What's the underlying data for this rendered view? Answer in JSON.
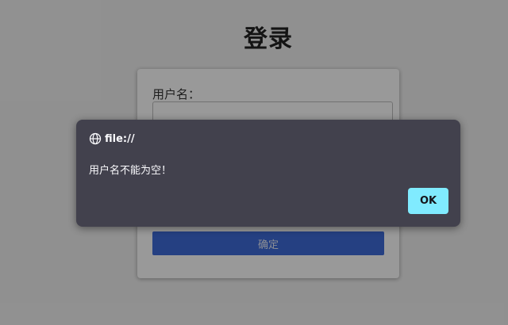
{
  "page": {
    "title": "登录"
  },
  "login_form": {
    "username_label": "用户名：",
    "username_value": "",
    "submit_label": "确定"
  },
  "alert": {
    "origin": "file://",
    "origin_icon": "globe-icon",
    "message": "用户名不能为空！",
    "ok_label": "OK"
  },
  "colors": {
    "submit_button": "#3f6bd9",
    "dialog_background": "#42414d",
    "ok_button": "#80ebff"
  }
}
